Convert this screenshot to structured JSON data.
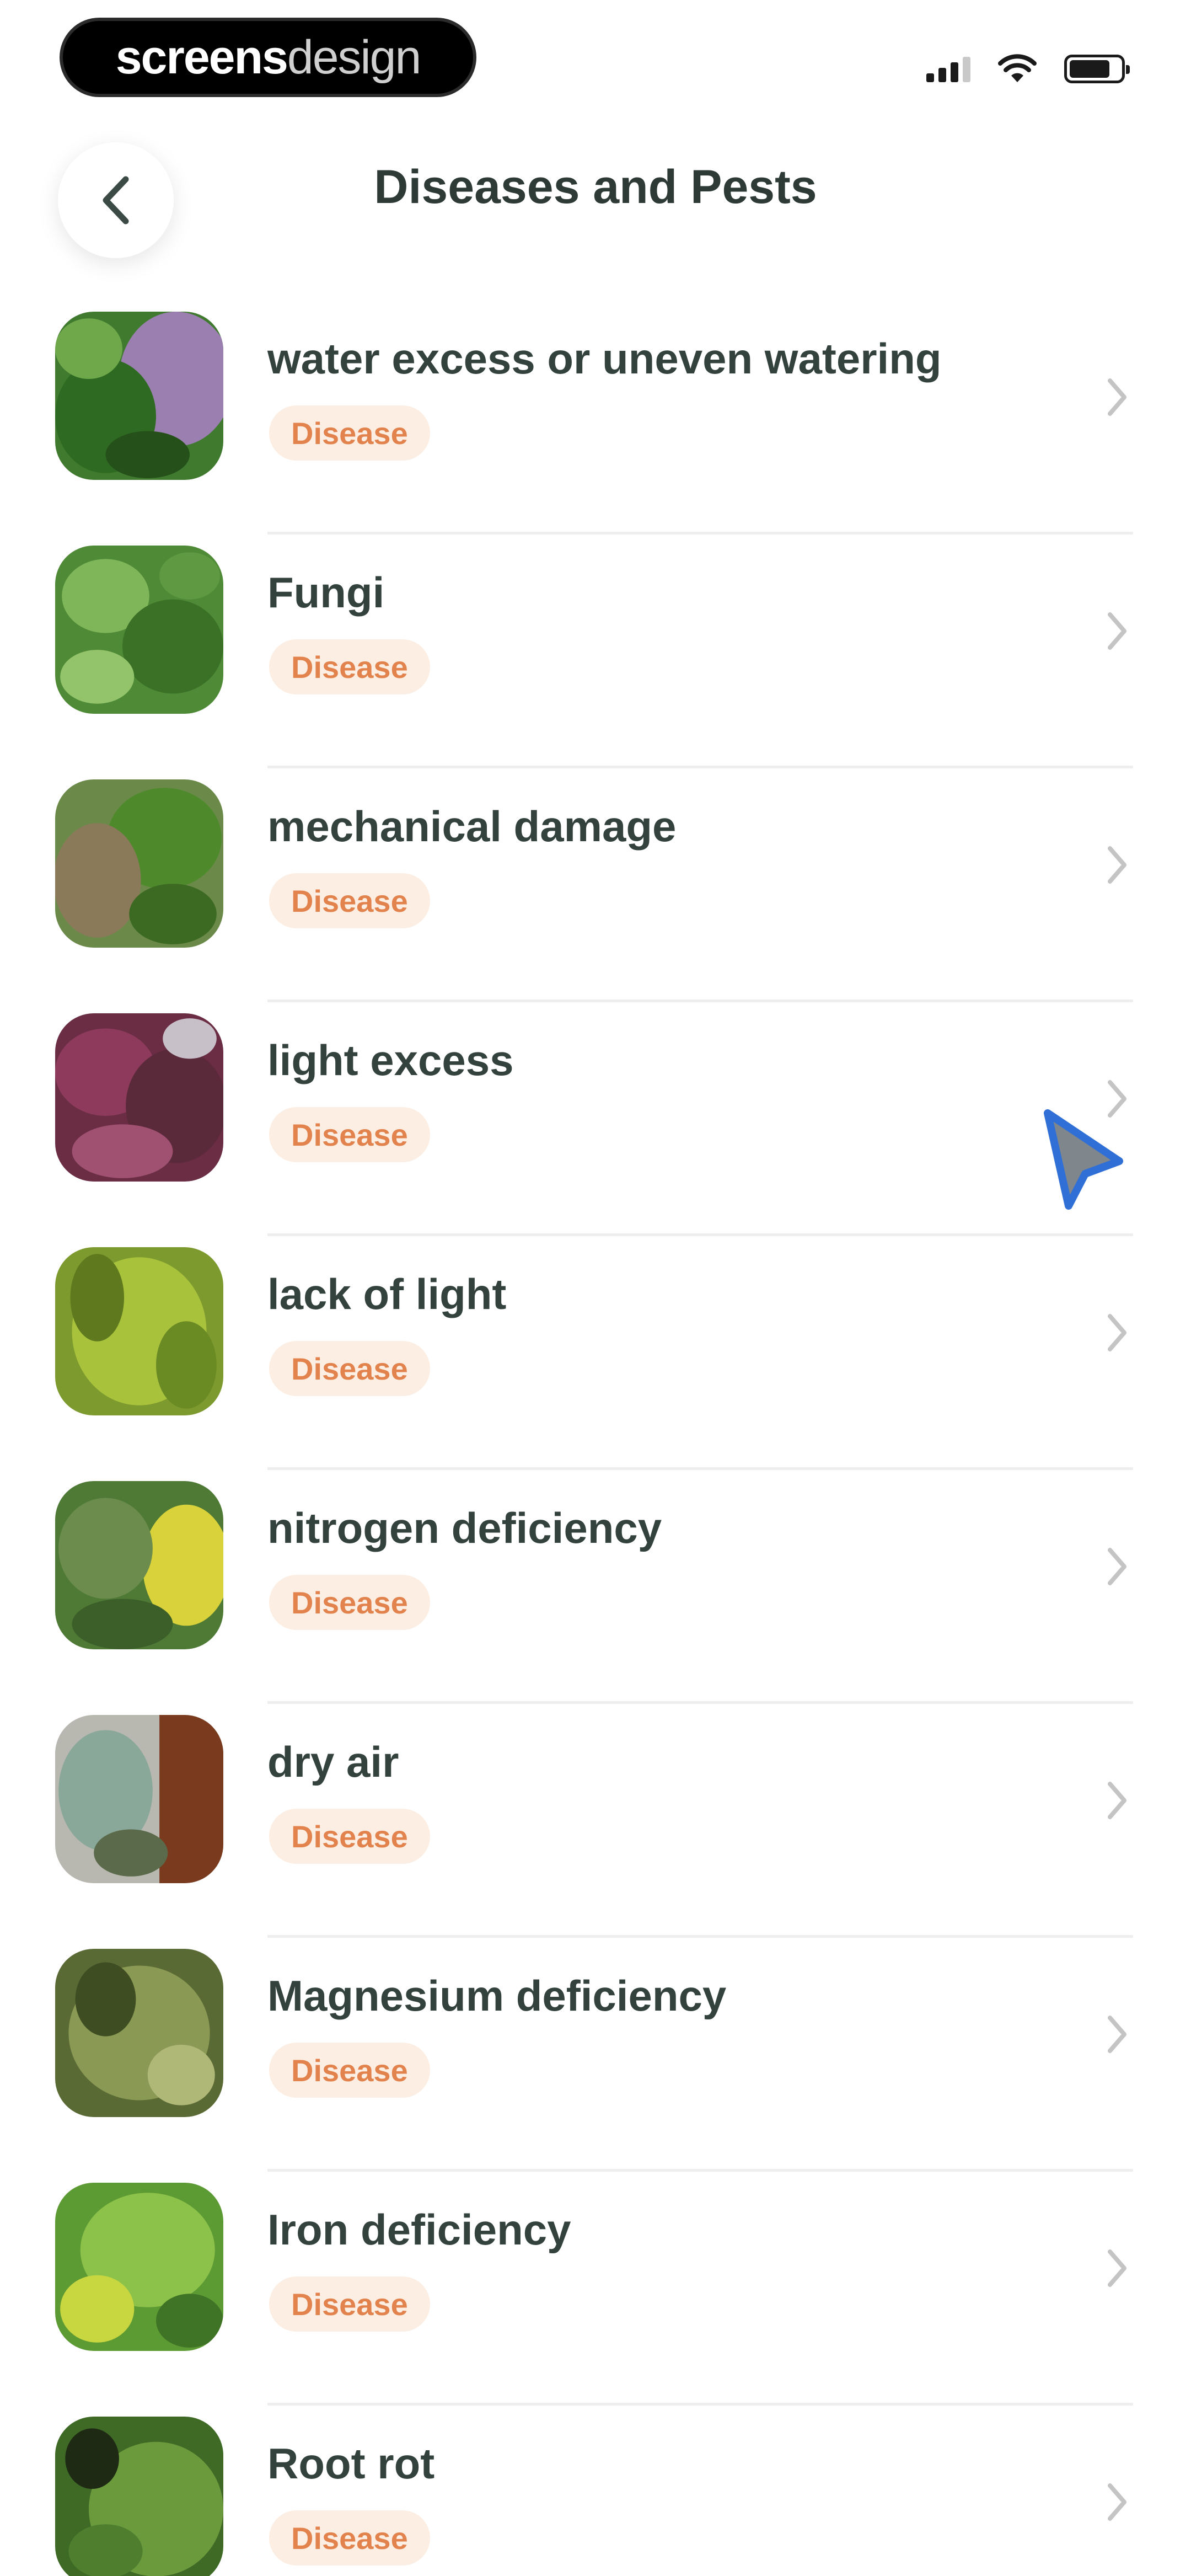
{
  "status_bar": {
    "watermark_bold": "screens",
    "watermark_light": "design",
    "icons": [
      "signal-icon",
      "wifi-icon",
      "battery-icon"
    ]
  },
  "header": {
    "back_icon": "chevron-left-icon",
    "title": "Diseases and Pests"
  },
  "items": [
    {
      "title": "water excess or uneven watering",
      "tag": "Disease"
    },
    {
      "title": "Fungi",
      "tag": "Disease"
    },
    {
      "title": "mechanical damage",
      "tag": "Disease"
    },
    {
      "title": "light excess",
      "tag": "Disease"
    },
    {
      "title": "lack of light",
      "tag": "Disease"
    },
    {
      "title": "nitrogen deficiency",
      "tag": "Disease"
    },
    {
      "title": "dry air",
      "tag": "Disease"
    },
    {
      "title": "Magnesium deficiency",
      "tag": "Disease"
    },
    {
      "title": "Iron deficiency",
      "tag": "Disease"
    },
    {
      "title": "Root rot",
      "tag": "Disease"
    }
  ],
  "colors": {
    "title_text": "#33423d",
    "badge_bg": "#fdeee3",
    "badge_text": "#e2834e",
    "pointer": "#2f6fd6"
  }
}
